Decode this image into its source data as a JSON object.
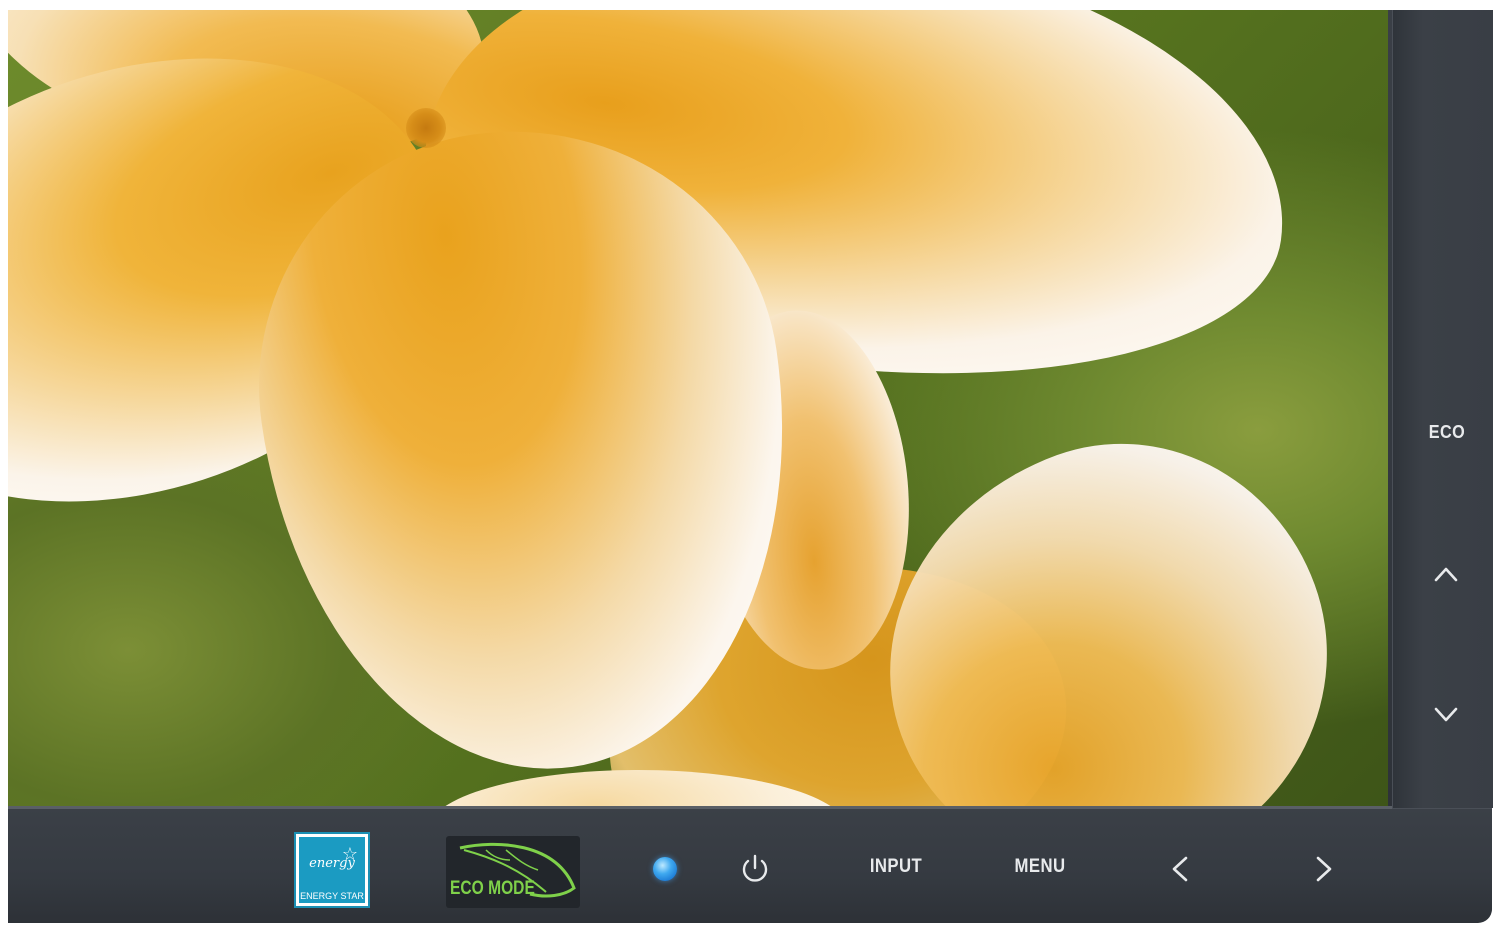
{
  "screen": {
    "content": "flower-photo"
  },
  "bezel": {
    "energy_star": {
      "logo_script": "energy",
      "label": "ENERGY STAR"
    },
    "eco_mode_badge": {
      "label": "ECO MODE"
    },
    "power_led": {
      "color": "#3fa9f0"
    },
    "buttons": {
      "power_icon": "power-icon",
      "input_label": "INPUT",
      "menu_label": "MENU",
      "left_icon": "chevron-left-icon",
      "right_icon": "chevron-right-icon",
      "eco_label": "ECO",
      "up_icon": "chevron-up-icon",
      "down_icon": "chevron-down-icon"
    },
    "colors": {
      "bezel": "#373c43",
      "label_text": "#e8eaec",
      "eco_green": "#7fd14a",
      "energy_star_blue": "#1b9bc2"
    }
  }
}
